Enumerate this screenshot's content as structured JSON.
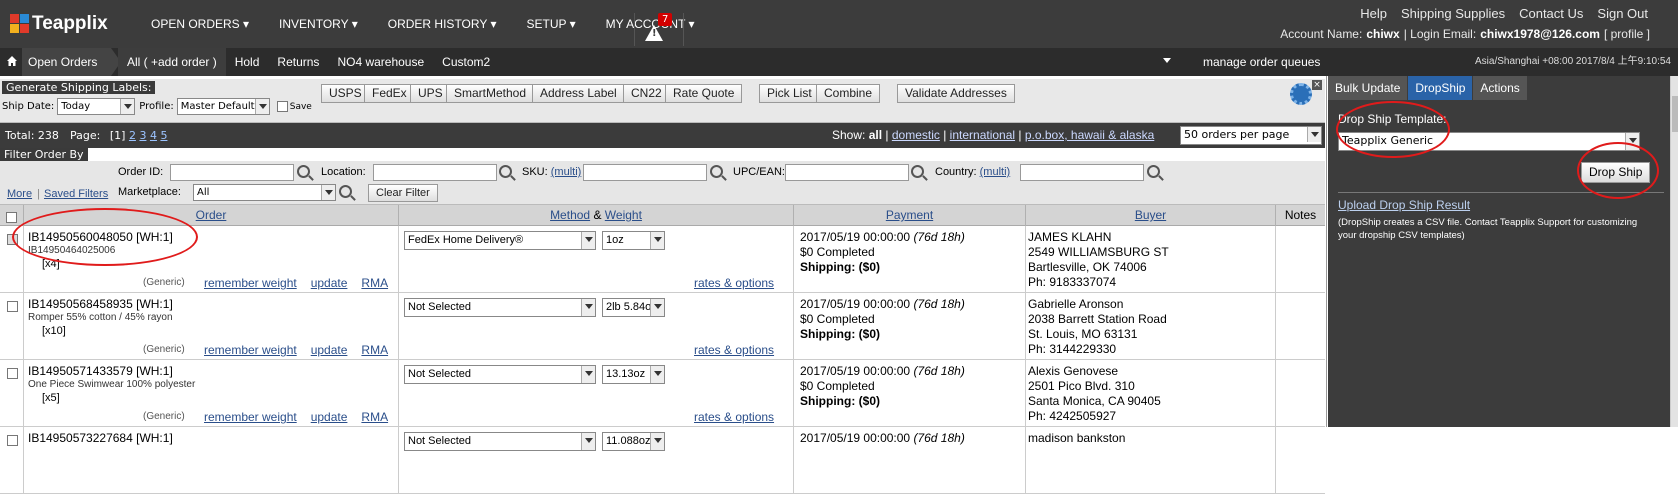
{
  "app": {
    "name": "Teapplix"
  },
  "nav": {
    "items": [
      {
        "label": "OPEN ORDERS ▾"
      },
      {
        "label": "INVENTORY ▾"
      },
      {
        "label": "ORDER HISTORY ▾"
      },
      {
        "label": "SETUP ▾"
      },
      {
        "label": "MY ACCOUNT ▾"
      }
    ],
    "alert_count": "7"
  },
  "toplinks": [
    {
      "label": "Help"
    },
    {
      "label": "Shipping Supplies"
    },
    {
      "label": "Contact Us"
    },
    {
      "label": "Sign Out"
    }
  ],
  "account": {
    "name_label": "Account Name:",
    "name": "chiwx",
    "email_label": "| Login Email:",
    "email": "chiwx1978@126.com",
    "profile": "[ profile ]"
  },
  "subbar": {
    "crumb": "Open Orders",
    "tabs": [
      {
        "label": "All  ( +add order )",
        "active": true
      },
      {
        "label": "Hold"
      },
      {
        "label": "Returns"
      },
      {
        "label": "NO4 warehouse"
      },
      {
        "label": "Custom2"
      }
    ],
    "manage": "manage order queues",
    "timezone": "Asia/Shanghai +08:00 2017/8/4 上午9:10:54"
  },
  "shipping": {
    "title": "Generate Shipping Labels:",
    "ship_date_label": "Ship Date:",
    "ship_date_value": "Today",
    "profile_label": "Profile:",
    "profile_value": "Master Default",
    "save_label": "Save",
    "buttons": [
      "USPS",
      "FedEx",
      "UPS",
      "SmartMethod",
      "Address Label",
      "CN22",
      "Rate Quote",
      "Pick List",
      "Combine",
      "Validate Addresses"
    ]
  },
  "totals": {
    "total": "Total: 238",
    "page_label": "Page:",
    "current_page": "[1]",
    "pages": [
      "2",
      "3",
      "4",
      "5"
    ],
    "show_label": "Show:",
    "show_all": "all",
    "show_domestic": "domestic",
    "show_international": "international",
    "show_pobox": "p.o.box, hawaii & alaska",
    "per_page": "50 orders per page"
  },
  "filter": {
    "title": "Filter Order By",
    "order_id": "Order ID:",
    "location": "Location:",
    "sku": "SKU:",
    "multi": "(multi)",
    "upc": "UPC/EAN:",
    "country": "Country:",
    "more": "More",
    "saved": "Saved Filters",
    "marketplace": "Marketplace:",
    "marketplace_value": "All",
    "clear": "Clear Filter"
  },
  "table": {
    "headers": {
      "order": "Order",
      "method": "Method",
      "amp": "&",
      "weight": "Weight",
      "payment": "Payment",
      "buyer": "Buyer",
      "notes": "Notes"
    },
    "link_remember": "remember weight",
    "link_update": "update",
    "link_rma": "RMA",
    "link_rates": "rates & options",
    "rows": [
      {
        "id": "IB14950560048050  [WH:1]",
        "sub": "IB14950464025006",
        "qty": "[x4]",
        "gen": "(Generic)",
        "method": "FedEx Home Delivery®",
        "weight": "1oz",
        "date": "2017/05/19 00:00:00",
        "age": "(76d 18h)",
        "status": "$0 Completed",
        "shipping": "Shipping: ($0)",
        "b1": "JAMES KLAHN",
        "b2": "2549 WILLIAMSBURG ST",
        "b3": "Bartlesville, OK 74006",
        "b4": "Ph: 9183337074",
        "checked": true
      },
      {
        "id": "IB14950568458935  [WH:1]",
        "sub": "Romper 55% cotton / 45% rayon",
        "qty": "[x10]",
        "gen": "(Generic)",
        "method": "Not Selected",
        "weight": "2lb 5.84o",
        "date": "2017/05/19 00:00:00",
        "age": "(76d 18h)",
        "status": "$0 Completed",
        "shipping": "Shipping: ($0)",
        "b1": "Gabrielle Aronson",
        "b2": "2038 Barrett Station Road",
        "b3": "St. Louis, MO 63131",
        "b4": "Ph: 3144229330"
      },
      {
        "id": "IB14950571433579  [WH:1]",
        "sub": "One Piece Swimwear 100% polyester",
        "qty": "[x5]",
        "gen": "(Generic)",
        "method": "Not Selected",
        "weight": "13.13oz",
        "date": "2017/05/19 00:00:00",
        "age": "(76d 18h)",
        "status": "$0 Completed",
        "shipping": "Shipping: ($0)",
        "b1": "Alexis Genovese",
        "b2": "2501 Pico Blvd. 310",
        "b3": "Santa Monica, CA 90405",
        "b4": "Ph: 4242505927"
      },
      {
        "id": "IB14950573227684  [WH:1]",
        "sub": "",
        "qty": "",
        "gen": "",
        "method": "Not Selected",
        "weight": "11.088oz",
        "date": "2017/05/19 00:00:00",
        "age": "(76d 18h)",
        "status": "",
        "shipping": "",
        "b1": "madison bankston",
        "b2": "",
        "b3": "",
        "b4": ""
      }
    ]
  },
  "dropship": {
    "tabs": [
      {
        "label": "Bulk Update"
      },
      {
        "label": "DropShip",
        "active": true
      },
      {
        "label": "Actions"
      }
    ],
    "template_label": "Drop Ship Template:",
    "template_value": "Teapplix Generic",
    "button": "Drop Ship",
    "upload": "Upload Drop Ship Result",
    "note": "(DropShip creates a CSV file. Contact Teapplix Support for customizing your dropship CSV templates)"
  },
  "colors": {
    "accent": "#2a63a8",
    "topbar": "#3c3c3c",
    "annotation": "#e01b1b",
    "link": "#2a4e8a"
  }
}
